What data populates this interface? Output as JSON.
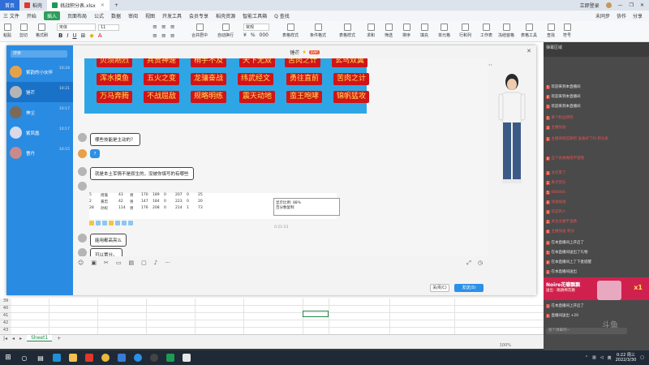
{
  "titlebar": {
    "tabs": [
      {
        "label": "首页",
        "kind": "home"
      },
      {
        "label": "稻壳",
        "kind": "wps"
      },
      {
        "label": "挑战积分表.xlsx",
        "kind": "file"
      }
    ],
    "add_tab": "+",
    "login": "未同步",
    "user": "立即登录"
  },
  "menubar": {
    "file": "三 文件",
    "items": [
      "开始",
      "插入",
      "页面布局",
      "公式",
      "数据",
      "审阅",
      "视图",
      "开发工具",
      "会员专享",
      "稻壳资源",
      "智能工具箱"
    ],
    "active": "开始",
    "search": "Q 查找",
    "right": [
      "未同步",
      "协作",
      "分享"
    ]
  },
  "toolbar": {
    "paste": "粘贴",
    "cut": "剪切",
    "copy": "复制",
    "format_painter": "格式刷",
    "font": "宋体",
    "font_size": "11",
    "merge": "合并居中",
    "wrap": "自动换行",
    "number_format": "常规",
    "table_style": "表格样式",
    "cond_format": "条件格式",
    "sum": "求和",
    "filter": "筛选",
    "sort": "排序",
    "fill": "填充",
    "cell": "单元格",
    "row_col": "行和列",
    "worksheet": "工作表",
    "freeze": "冻结窗格",
    "table_tools": "表格工具",
    "find": "查找",
    "symbol": "符号"
  },
  "sheet": {
    "rows": [
      "39",
      "40",
      "41",
      "42",
      "43",
      "44"
    ],
    "sheet_tab": "Sheet1",
    "add_sheet": "+",
    "zoom": "100%"
  },
  "qq": {
    "search_placeholder": "搜索",
    "title": "锤芒",
    "title_badge": "SVIP",
    "contacts": [
      {
        "name": "紫韵的小伙伴",
        "time": "10:24"
      },
      {
        "name": "锤芒",
        "time": "10:21"
      },
      {
        "name": "神尘",
        "time": "10:17"
      },
      {
        "name": "紫凤凰",
        "time": "10:17"
      },
      {
        "name": "曹丹",
        "time": "10:15"
      }
    ],
    "phrases": [
      "贝须刚烈",
      "兵贵神速",
      "稍手不及",
      "天下无双",
      "苦肉之计",
      "玄鸟双翼",
      "浑水摸鱼",
      "五火之变",
      "龙骧奋战",
      "纬武经文",
      "勇往直前",
      "苦肉之计",
      "万马奔腾",
      "不战屈敌",
      "规略明练",
      "震天动地",
      "蛮王咆哮",
      "锦帆猛攻"
    ],
    "messages": [
      {
        "text": "哪些技能是主动的？"
      },
      {
        "text": "?"
      },
      {
        "text": "就是本土军情不是原生的，没被你填写的有哪些"
      },
      {
        "text": "能用都高亮么"
      },
      {
        "text": "可以置分。"
      }
    ],
    "table_rows": [
      [
        "5",
        "周瑜",
        "43",
        "男",
        "170",
        "189",
        "0",
        "207",
        "0",
        "25"
      ],
      [
        "2",
        "黄忠",
        "42",
        "男",
        "147",
        "184",
        "0",
        "223",
        "0",
        "20"
      ],
      [
        "28",
        "孙权",
        "114",
        "男",
        "176",
        "208",
        "0",
        "214",
        "1",
        "73"
      ]
    ],
    "popup_line1": "显示比例: 88%",
    "popup_line2": "百分数复制",
    "timestamp": "0:21:53",
    "close_label": "关闭(C)",
    "send_label": "发送(S)"
  },
  "live": {
    "top_text": "弹幕区域",
    "messages": [
      {
        "lv": "5",
        "text": "欢迎来到本直播间",
        "white": true
      },
      {
        "lv": "4",
        "text": "欢迎来到本直播间",
        "white": true
      },
      {
        "lv": "3",
        "text": "欢迎来到本直播间",
        "white": true
      },
      {
        "lv": "5",
        "text": "来个粉丝牌吧",
        "white": false
      },
      {
        "lv": "3",
        "text": "主播加油",
        "white": false
      },
      {
        "lv": "2",
        "text": "主播请唱首歌吧 准备好了吗 积分表",
        "white": false
      },
      {
        "lv": "4",
        "text": "这个表格做得不错哦",
        "white": false
      },
      {
        "lv": "3",
        "text": "太厉害了",
        "white": false
      },
      {
        "lv": "2",
        "text": "来点音乐",
        "white": false
      },
      {
        "lv": "5",
        "text": "666666",
        "white": false
      },
      {
        "lv": "4",
        "text": "加油加油",
        "white": false
      },
      {
        "lv": "3",
        "text": "欢迎新人",
        "white": false
      },
      {
        "lv": "2",
        "text": "关注主播不迷路",
        "white": false
      },
      {
        "lv": "4",
        "text": "主播加油 积分",
        "white": false
      },
      {
        "lv": "3",
        "text": "在本直播间上开启了",
        "white": true
      },
      {
        "lv": "5",
        "text": "在本直播间送出了礼物",
        "white": true
      },
      {
        "lv": "4",
        "text": "在本直播间上了下麦提醒",
        "white": true
      },
      {
        "lv": "2",
        "text": "在本直播间送出",
        "white": true
      },
      {
        "lv": "3",
        "text": "在本直播间上开启了",
        "white": true
      },
      {
        "lv": "4",
        "text": "直播间送出 +20",
        "white": true
      }
    ],
    "gift_name": "Noire花瓣飘飘",
    "gift_sub": "送出 · 跳跳棉花糖",
    "gift_count": "x1",
    "input_placeholder": "发个弹幕吧~",
    "watermark": "斗鱼"
  },
  "taskbar": {
    "time": "0:22 周三",
    "date": "2022/3/30",
    "lang": "英"
  }
}
